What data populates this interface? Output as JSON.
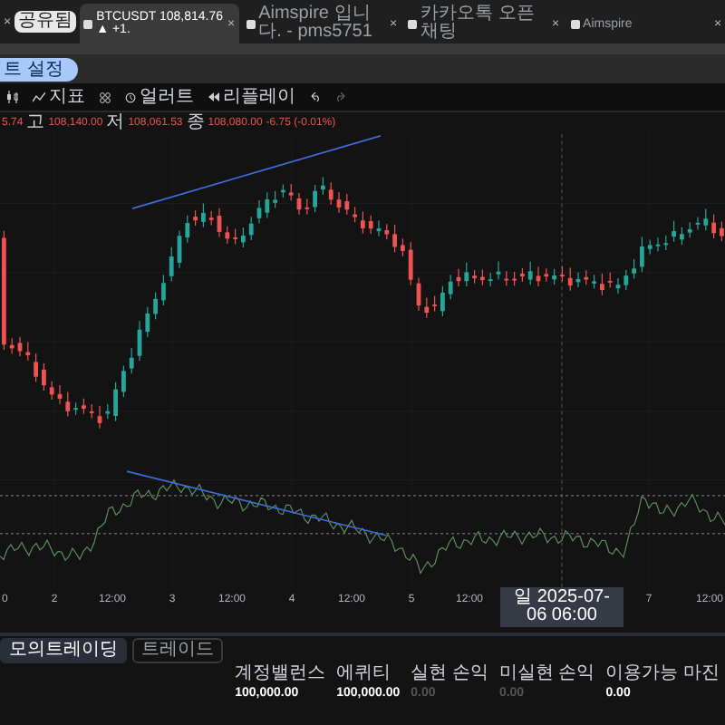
{
  "leading_close": "×",
  "browser_tabs": [
    {
      "label": "공유됨",
      "kind": "badge"
    },
    {
      "label": "BTCUSDT 108,814.76 ▲ +1.",
      "kind": "tab",
      "selected": true,
      "close": "×"
    },
    {
      "label": "Aimspire 입니다. - pms5751",
      "kind": "tab",
      "selected": false,
      "close": "×"
    },
    {
      "label": "카카오톡 오픈채팅",
      "kind": "tab",
      "selected": false,
      "close": "×"
    },
    {
      "label": "Aimspire",
      "kind": "tab",
      "selected": false,
      "close": "×"
    }
  ],
  "banner_button": "트 설정",
  "toolbar": {
    "indicators": "지표",
    "alert": "얼러트",
    "replay": "리플레이"
  },
  "ohlc": {
    "open": "5.74",
    "high_label": "고",
    "high": "108,140.00",
    "low_label": "저",
    "low": "108,061.53",
    "close_label": "종",
    "close": "108,080.00",
    "change": "-6.75 (-0.01%)"
  },
  "time_axis": [
    {
      "label": "0",
      "kind": "tick"
    },
    {
      "label": "2",
      "kind": "tick"
    },
    {
      "label": "12:00",
      "kind": "tick"
    },
    {
      "label": "3",
      "kind": "tick"
    },
    {
      "label": "12:00",
      "kind": "tick"
    },
    {
      "label": "4",
      "kind": "tick"
    },
    {
      "label": "12:00",
      "kind": "tick"
    },
    {
      "label": "5",
      "kind": "tick"
    },
    {
      "label": "12:00",
      "kind": "tick"
    },
    {
      "label": "일 2025-07-06  06:00",
      "kind": "cursor"
    },
    {
      "label": "7",
      "kind": "tick"
    },
    {
      "label": "12:00",
      "kind": "tick"
    }
  ],
  "panel_tabs": [
    {
      "label": "모의트레이딩",
      "selected": true
    },
    {
      "label": "트레이드",
      "selected": false
    }
  ],
  "account": [
    {
      "label": "계정밸런스",
      "value": "100,000.00",
      "muted": false
    },
    {
      "label": "에퀴티",
      "value": "100,000.00",
      "muted": false
    },
    {
      "label": "실현 손익",
      "value": "0.00",
      "muted": true
    },
    {
      "label": "미실현 손익",
      "value": "0.00",
      "muted": true
    },
    {
      "label": "이용가능 마진",
      "value": "0.00",
      "muted": false
    }
  ]
}
